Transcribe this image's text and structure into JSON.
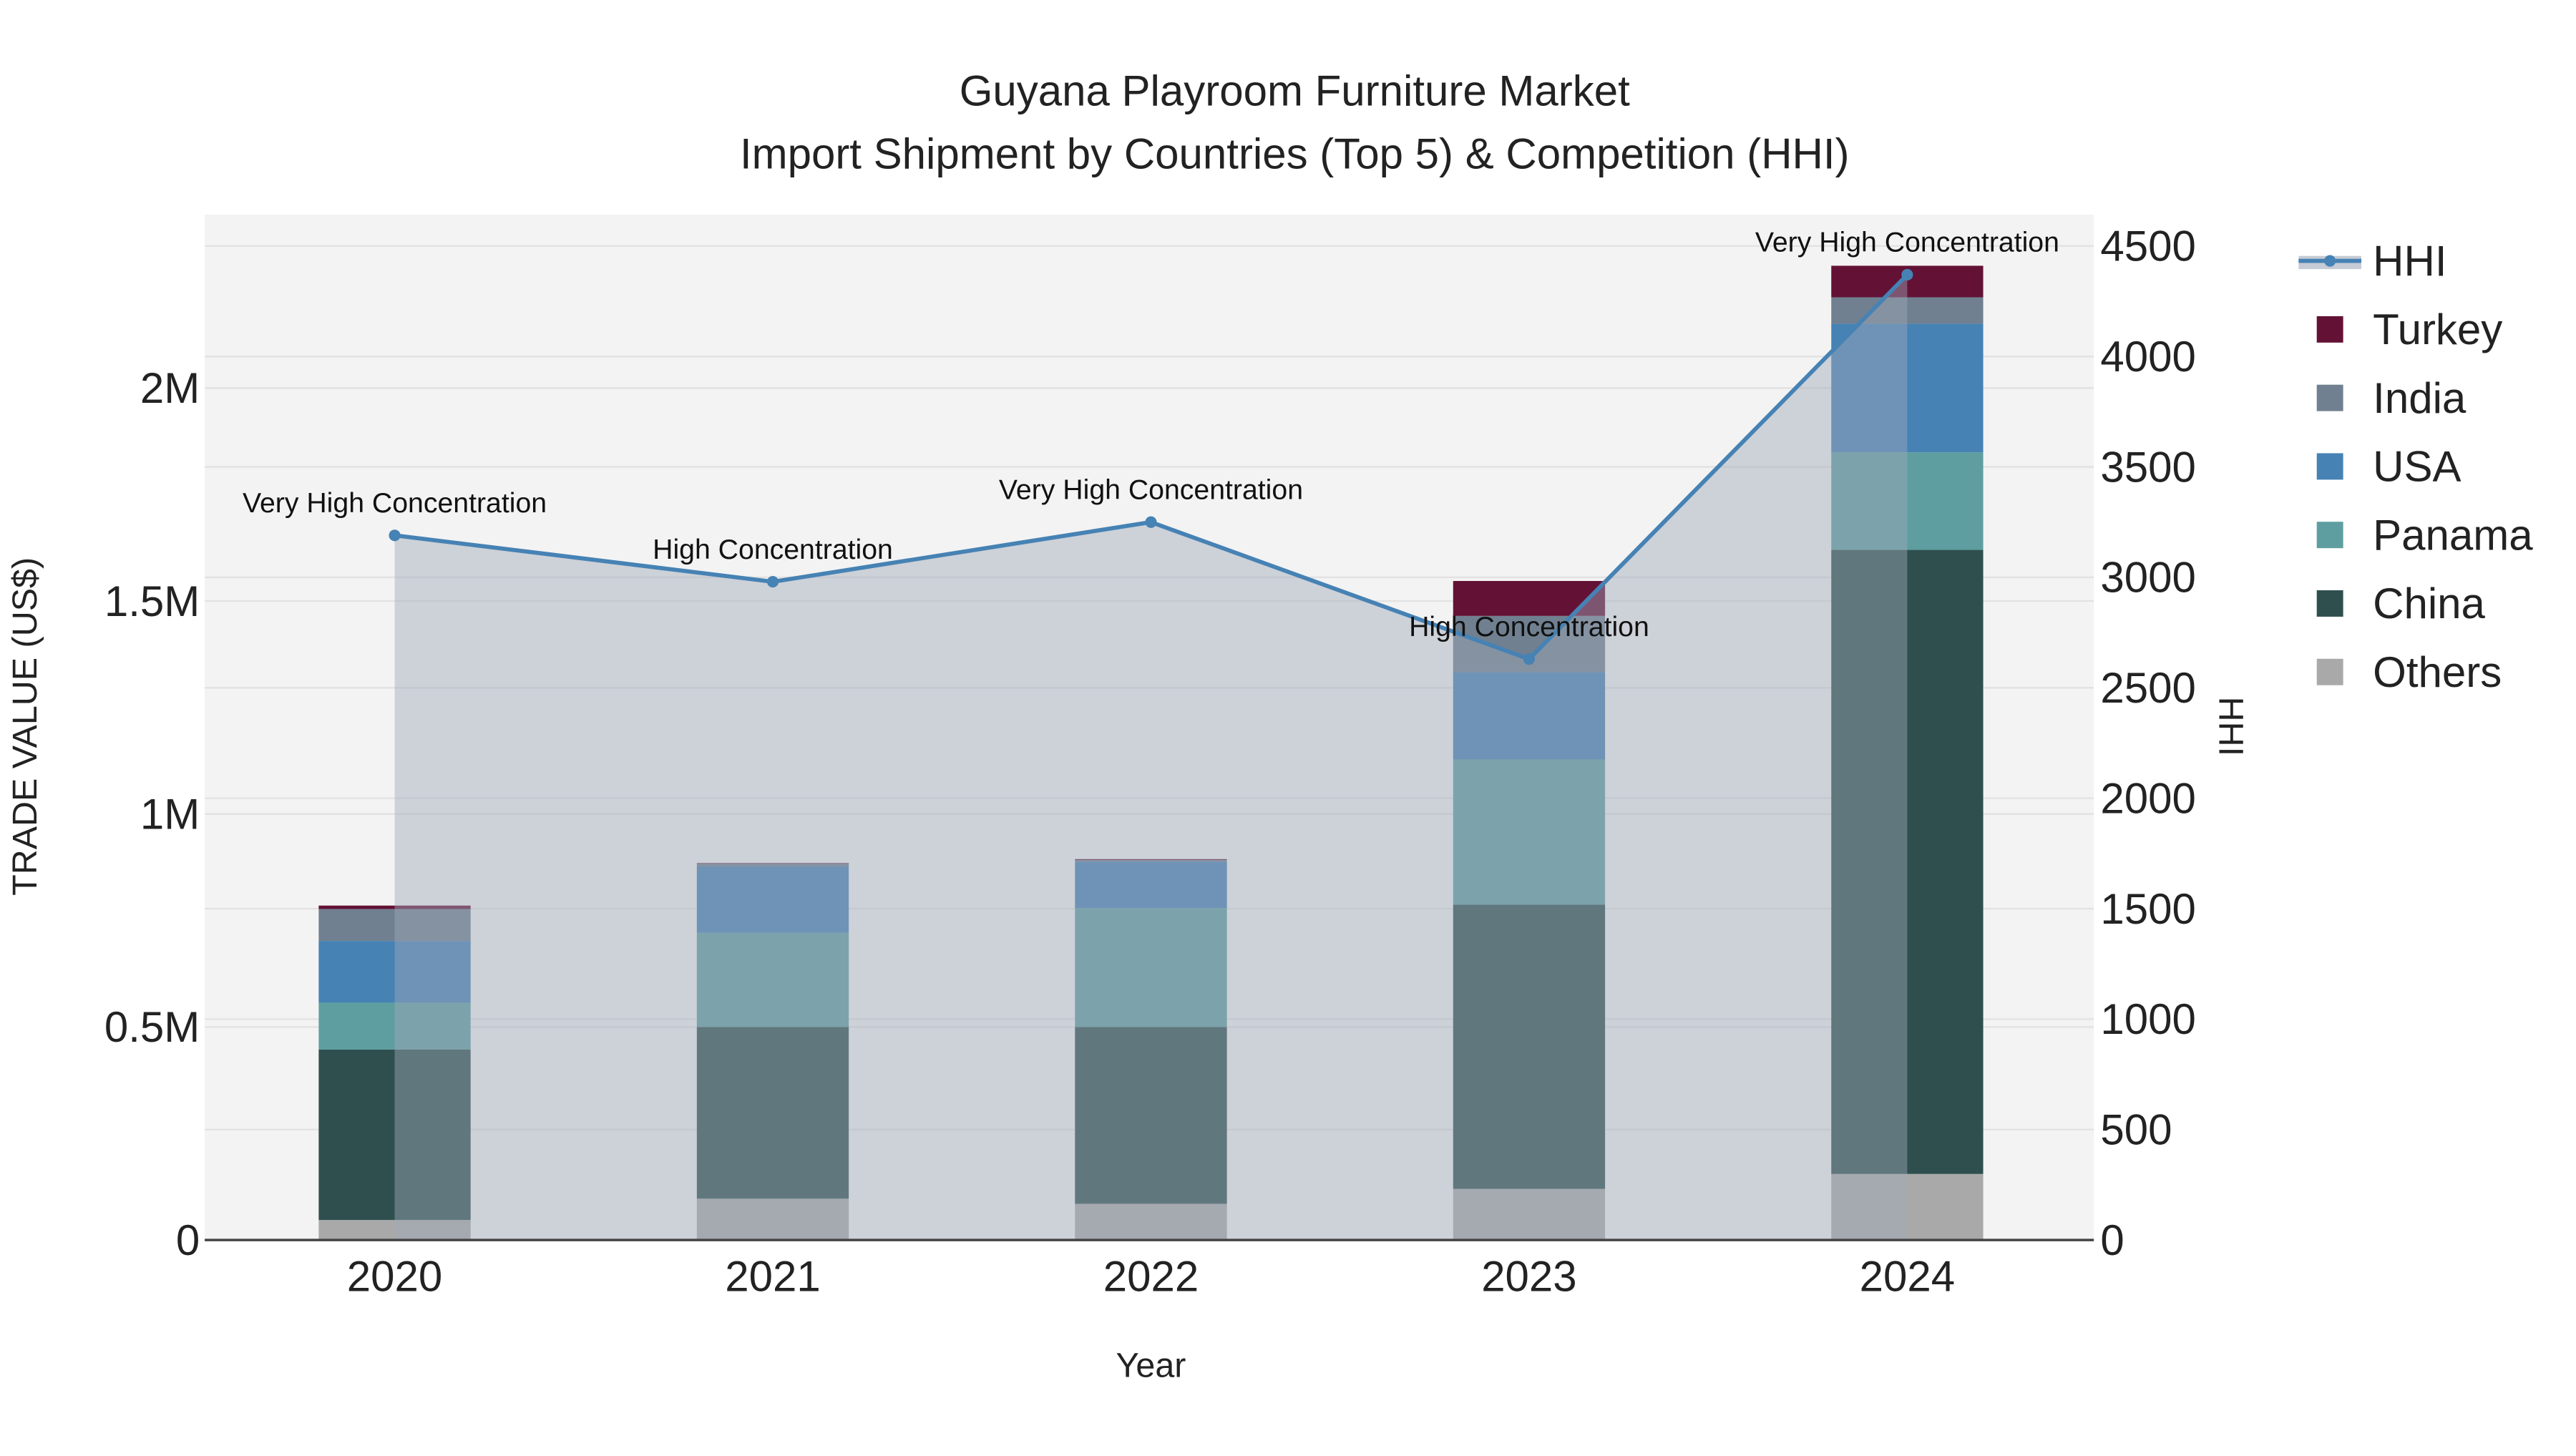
{
  "chart_data": {
    "type": "bar",
    "title": "Guyana Playroom Furniture Market",
    "subtitle": "Import Shipment by Countries (Top 5) & Competition (HHI)",
    "xlabel": "Year",
    "ylabel": "TRADE VALUE (US$)",
    "y2label": "HHI",
    "categories": [
      "2020",
      "2021",
      "2022",
      "2023",
      "2024"
    ],
    "ylim": [
      0,
      2400000
    ],
    "yticks": [
      0,
      500000,
      1000000,
      1500000,
      2000000
    ],
    "ytick_labels": [
      "0",
      "0.5M",
      "1M",
      "1.5M",
      "2M"
    ],
    "y2lim": [
      0,
      4640
    ],
    "y2ticks": [
      0,
      500,
      1000,
      1500,
      2000,
      2500,
      3000,
      3500,
      4000,
      4500
    ],
    "y2tick_labels": [
      "0",
      "500",
      "1000",
      "1500",
      "2000",
      "2500",
      "3000",
      "3500",
      "4000",
      "4500"
    ],
    "stacked": true,
    "series": [
      {
        "name": "Others",
        "color": "#a9a9a9",
        "values": [
          47000,
          97000,
          85000,
          120000,
          155000
        ]
      },
      {
        "name": "China",
        "color": "#2f4f4f",
        "values": [
          400000,
          403000,
          415000,
          667000,
          1465000
        ]
      },
      {
        "name": "Panama",
        "color": "#5f9ea0",
        "values": [
          110000,
          221000,
          279000,
          341000,
          229000
        ]
      },
      {
        "name": "USA",
        "color": "#4682b4",
        "values": [
          145000,
          155000,
          109000,
          205000,
          302000
        ]
      },
      {
        "name": "India",
        "color": "#708090",
        "values": [
          75000,
          8000,
          4000,
          132000,
          62000
        ]
      },
      {
        "name": "Turkey",
        "color": "#631235",
        "values": [
          8000,
          1000,
          2000,
          82000,
          74000
        ]
      }
    ],
    "line": {
      "name": "HHI",
      "color": "#4682b4",
      "axis": "right",
      "values": [
        3190,
        2980,
        3250,
        2630,
        4370
      ]
    },
    "annotations": [
      "Very High Concentration",
      "High Concentration",
      "Very High Concentration",
      "High Concentration",
      "Very High Concentration"
    ],
    "legend": [
      "HHI",
      "Turkey",
      "India",
      "USA",
      "Panama",
      "China",
      "Others"
    ],
    "legend_position": "right",
    "grid": true
  }
}
